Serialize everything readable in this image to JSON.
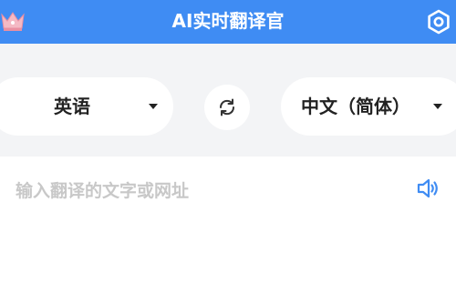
{
  "header": {
    "title": "AI实时翻译官",
    "crown_icon": "crown-icon",
    "settings_icon": "settings-hexagon-icon",
    "background": "#3f8cf3"
  },
  "languages": {
    "source": "英语",
    "target": "中文（简体）",
    "swap_icon": "swap-arrows-icon"
  },
  "input": {
    "placeholder": "输入翻译的文字或网址",
    "speaker_icon": "speaker-icon",
    "accent": "#3f8cf3"
  }
}
